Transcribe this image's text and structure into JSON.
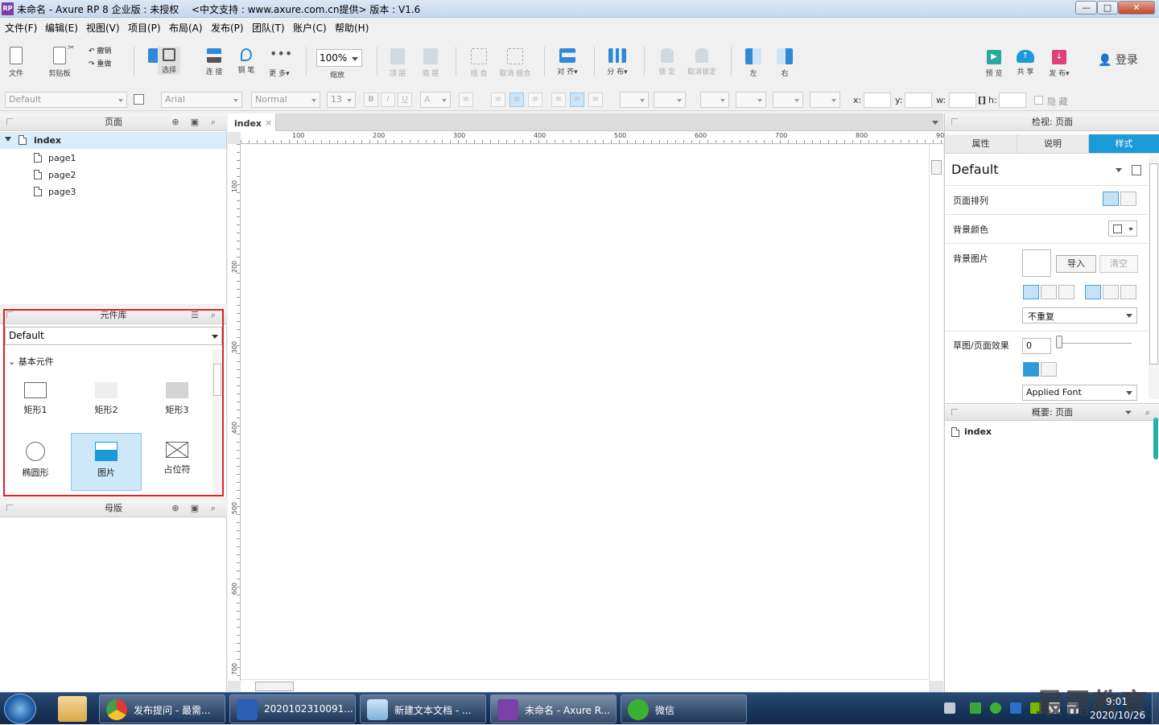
{
  "window": {
    "title": "未命名 - Axure RP 8 企业版 : 未授权",
    "subtitle": "<中文支持 : www.axure.com.cn提供> 版本 : V1.6",
    "logo_text": "RP",
    "controls": {
      "minimize": "—",
      "maximize": "□",
      "close": "✕"
    }
  },
  "menu": [
    "文件(F)",
    "编辑(E)",
    "视图(V)",
    "项目(P)",
    "布局(A)",
    "发布(P)",
    "团队(T)",
    "账户(C)",
    "帮助(H)"
  ],
  "toolbar": {
    "file": "文件",
    "clipboard": "剪贴板",
    "undo": "撤销",
    "redo": "重做",
    "select": "选择",
    "connect": "连 接",
    "pen": "钢 笔",
    "more": "更 多▾",
    "zoom_value": "100%",
    "zoom_label": "缩放",
    "top_layer": "顶 层",
    "bottom_layer": "底 层",
    "group": "组 合",
    "ungroup": "取消 组合",
    "align": "对 齐▾",
    "distribute": "分 布▾",
    "lock": "锁 定",
    "unlock": "取消锁定",
    "left": "左",
    "right": "右",
    "preview": "预 览",
    "share": "共 享",
    "publish": "发 布▾",
    "login": "登录"
  },
  "format_bar": {
    "style": "Default",
    "font": "Arial",
    "weight": "Normal",
    "size": "13",
    "bold": "B",
    "italic": "I",
    "underline": "U",
    "font_color": "A",
    "x_label": "x:",
    "y_label": "y:",
    "w_label": "w:",
    "h_label": "h:",
    "hide_label": "隐 藏"
  },
  "pages_panel": {
    "title": "页面",
    "pages": [
      {
        "name": "index",
        "selected": true
      },
      {
        "name": "page1"
      },
      {
        "name": "page2"
      },
      {
        "name": "page3"
      }
    ]
  },
  "library_panel": {
    "title": "元件库",
    "library": "Default",
    "category": "基本元件",
    "widgets": [
      {
        "label": "矩形1"
      },
      {
        "label": "矩形2"
      },
      {
        "label": "矩形3"
      },
      {
        "label": "椭圆形"
      },
      {
        "label": "图片",
        "selected": true
      },
      {
        "label": "占位符"
      }
    ]
  },
  "masters_panel": {
    "title": "母版"
  },
  "canvas": {
    "tab": "index",
    "h_ticks": [
      "100",
      "200",
      "300",
      "400",
      "500",
      "600",
      "700",
      "800",
      "90"
    ],
    "v_ticks": [
      "100",
      "200",
      "300",
      "400",
      "500",
      "600",
      "700"
    ]
  },
  "inspector": {
    "title": "检视: 页面",
    "tabs": [
      "属性",
      "说明",
      "样式"
    ],
    "active_tab": "样式",
    "style_name": "Default",
    "page_align_label": "页面排列",
    "bg_color_label": "背景颜色",
    "bg_image_label": "背景图片",
    "import_btn": "导入",
    "clear_btn": "清空",
    "repeat_value": "不重复",
    "sketch_label": "草图/页面效果",
    "sketch_value": "0",
    "font_value": "Applied Font"
  },
  "outline_panel": {
    "title": "概要: 页面",
    "item": "index"
  },
  "taskbar": {
    "items": [
      "发布提问 - 最需...",
      "2020102310091...",
      "新建文本文档 - ...",
      "未命名 - Axure R...",
      "微信"
    ],
    "time": "9:01",
    "date": "2020/10/26",
    "watermark": "最需教育"
  },
  "colors": {
    "accent": "#1a9ad6",
    "highlight_box": "#e02020",
    "selection": "#cde8f8"
  }
}
